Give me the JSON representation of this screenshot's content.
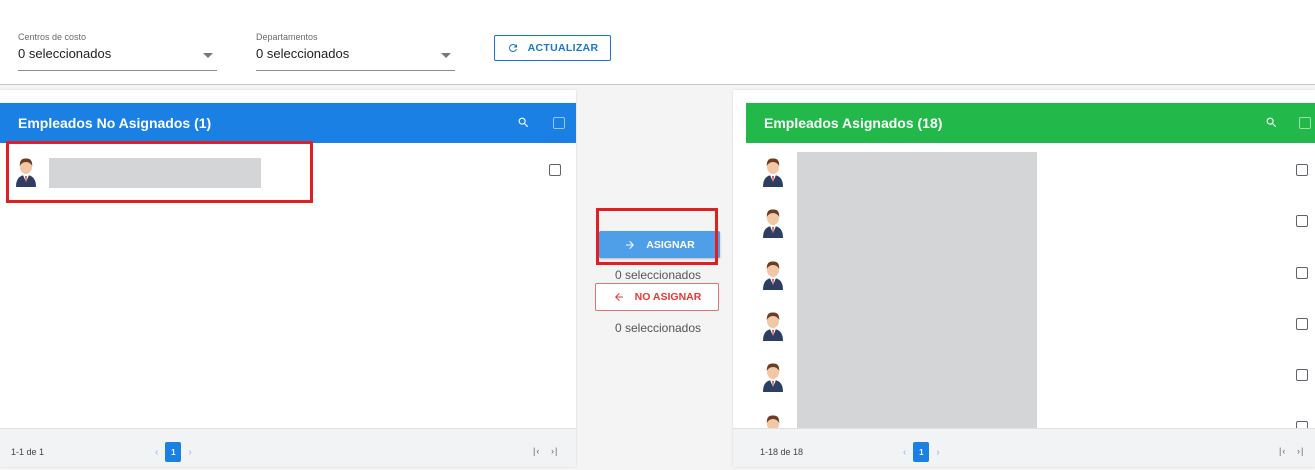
{
  "filters": {
    "cost_centers": {
      "label": "Centros de costo",
      "value": "0 seleccionados"
    },
    "departments": {
      "label": "Departamentos",
      "value": "0 seleccionados"
    },
    "refresh_label": "ACTUALIZAR",
    "refresh_icon": "refresh-icon"
  },
  "left_panel": {
    "title": "Empleados No Asignados (1)",
    "header_color": "#1a80e3",
    "pagination_range": "1-1 de 1",
    "current_page": "1",
    "rows": 1
  },
  "right_panel": {
    "title": "Empleados Asignados (18)",
    "header_color": "#22b94a",
    "pagination_range": "1-18 de 18",
    "current_page": "1",
    "visible_rows": 6
  },
  "actions": {
    "assign_label": "ASIGNAR",
    "assign_selected": "0 seleccionados",
    "unassign_label": "NO ASIGNAR",
    "unassign_selected": "0 seleccionados"
  },
  "colors": {
    "highlight": "#e02020",
    "assign": "#4f9ee8",
    "unassign": "#e53935"
  }
}
